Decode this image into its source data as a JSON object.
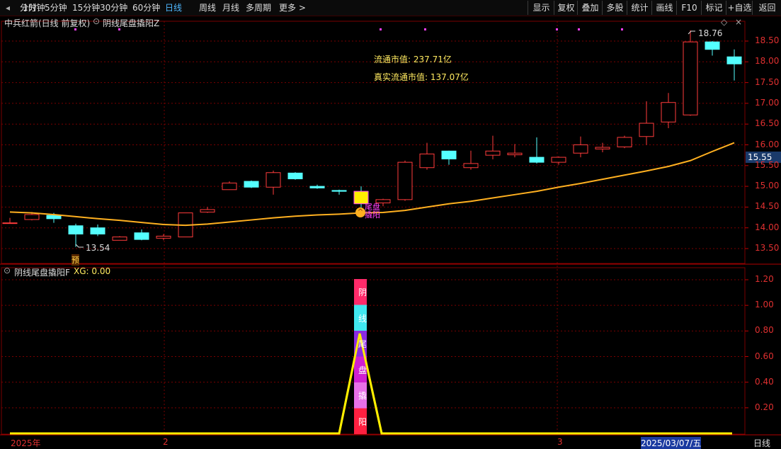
{
  "toolbar": {
    "periods": [
      "分时",
      "1分钟",
      "5分钟",
      "15分钟",
      "30分钟",
      "60分钟",
      "日线",
      "周线",
      "月线",
      "多周期",
      "更多 >"
    ],
    "active_period": "日线",
    "right_buttons": [
      "显示",
      "复权",
      "叠加",
      "多股",
      "统计",
      "画线",
      "F10",
      "标记",
      "+自选",
      "返回"
    ]
  },
  "main_panel": {
    "stock_title": "中兵红箭(日线 前复权)",
    "indicator_name": "阴线尾盘撬阳Z",
    "circ_value_label": "流通市值: 237.71亿",
    "real_circ_value_label": "真实流通市值: 137.07亿",
    "high_label": "18.76",
    "low_label": "13.54",
    "yu_marker": "预",
    "signal_label": "尾盘撬阳",
    "current_price": "15.55",
    "y_ticks": [
      "18.50",
      "18.00",
      "17.50",
      "17.00",
      "16.50",
      "16.00",
      "15.50",
      "15.00",
      "14.50",
      "14.00",
      "13.50"
    ]
  },
  "sub_panel": {
    "indicator_title": "阴线尾盘撬阳F",
    "xg_label": "XG: 0.00",
    "y_ticks": [
      "1.20",
      "1.00",
      "0.80",
      "0.60",
      "0.40",
      "0.20"
    ],
    "signal_chars": [
      "阴",
      "线",
      "尾",
      "盘",
      "撬",
      "阳"
    ]
  },
  "date_axis": {
    "labels": [
      "2025年",
      "2",
      "3"
    ],
    "highlight": "2025/03/07/五",
    "period_label": "日线"
  },
  "colors": {
    "up": "#ff3b3b",
    "down": "#54ffff",
    "ma": "#ffb020",
    "signal": "#ffee00",
    "grid": "#7a0000"
  },
  "chart_data": {
    "type": "candlestick",
    "ylim": [
      13.2,
      18.9
    ],
    "candles": [
      {
        "o": 14.12,
        "h": 14.24,
        "l": 14.12,
        "c": 14.12
      },
      {
        "o": 14.2,
        "h": 14.38,
        "l": 14.18,
        "c": 14.32
      },
      {
        "o": 14.3,
        "h": 14.36,
        "l": 14.12,
        "c": 14.22
      },
      {
        "o": 14.05,
        "h": 14.1,
        "l": 13.54,
        "c": 13.85
      },
      {
        "o": 14.0,
        "h": 14.08,
        "l": 13.8,
        "c": 13.85
      },
      {
        "o": 13.7,
        "h": 13.8,
        "l": 13.7,
        "c": 13.78
      },
      {
        "o": 13.88,
        "h": 13.96,
        "l": 13.7,
        "c": 13.72
      },
      {
        "o": 13.75,
        "h": 13.85,
        "l": 13.7,
        "c": 13.8
      },
      {
        "o": 13.78,
        "h": 14.36,
        "l": 13.78,
        "c": 14.36
      },
      {
        "o": 14.38,
        "h": 14.5,
        "l": 14.36,
        "c": 14.44
      },
      {
        "o": 14.92,
        "h": 15.12,
        "l": 14.92,
        "c": 15.08
      },
      {
        "o": 15.12,
        "h": 15.14,
        "l": 14.96,
        "c": 14.98
      },
      {
        "o": 14.98,
        "h": 15.38,
        "l": 14.8,
        "c": 15.33
      },
      {
        "o": 15.32,
        "h": 15.34,
        "l": 15.16,
        "c": 15.18
      },
      {
        "o": 15.0,
        "h": 15.04,
        "l": 14.94,
        "c": 14.96
      },
      {
        "o": 14.9,
        "h": 14.92,
        "l": 14.8,
        "c": 14.88
      },
      {
        "o": 14.88,
        "h": 15.0,
        "l": 14.38,
        "c": 14.58
      },
      {
        "o": 14.6,
        "h": 14.7,
        "l": 14.52,
        "c": 14.68
      },
      {
        "o": 14.68,
        "h": 15.62,
        "l": 14.65,
        "c": 15.58
      },
      {
        "o": 15.45,
        "h": 16.05,
        "l": 15.4,
        "c": 15.78
      },
      {
        "o": 15.85,
        "h": 15.86,
        "l": 15.52,
        "c": 15.66
      },
      {
        "o": 15.45,
        "h": 15.86,
        "l": 15.4,
        "c": 15.55
      },
      {
        "o": 15.75,
        "h": 16.22,
        "l": 15.65,
        "c": 15.85
      },
      {
        "o": 15.76,
        "h": 16.02,
        "l": 15.7,
        "c": 15.8
      },
      {
        "o": 15.7,
        "h": 16.18,
        "l": 15.55,
        "c": 15.58
      },
      {
        "o": 15.58,
        "h": 15.72,
        "l": 15.52,
        "c": 15.7
      },
      {
        "o": 15.8,
        "h": 16.2,
        "l": 15.7,
        "c": 16.0
      },
      {
        "o": 15.9,
        "h": 16.05,
        "l": 15.82,
        "c": 15.94
      },
      {
        "o": 15.95,
        "h": 16.22,
        "l": 15.92,
        "c": 16.18
      },
      {
        "o": 16.2,
        "h": 17.05,
        "l": 16.0,
        "c": 16.52
      },
      {
        "o": 16.55,
        "h": 17.25,
        "l": 16.4,
        "c": 17.02
      },
      {
        "o": 16.72,
        "h": 18.76,
        "l": 16.7,
        "c": 18.48
      },
      {
        "o": 18.48,
        "h": 18.5,
        "l": 18.15,
        "c": 18.3
      },
      {
        "o": 18.12,
        "h": 18.3,
        "l": 17.55,
        "c": 17.95
      }
    ],
    "ma": [
      14.38,
      14.36,
      14.32,
      14.27,
      14.22,
      14.18,
      14.13,
      14.08,
      14.06,
      14.09,
      14.14,
      14.19,
      14.24,
      14.28,
      14.31,
      14.33,
      14.36,
      14.37,
      14.42,
      14.5,
      14.58,
      14.64,
      14.72,
      14.8,
      14.88,
      14.98,
      15.07,
      15.17,
      15.27,
      15.37,
      15.48,
      15.62,
      15.84,
      16.05
    ],
    "signal_index": 16,
    "xg_values": [
      0,
      0,
      0,
      0,
      0,
      0,
      0,
      0,
      0,
      0,
      0,
      0,
      0,
      0,
      0,
      0,
      0.78,
      0,
      0,
      0,
      0,
      0,
      0,
      0,
      0,
      0,
      0,
      0,
      0,
      0,
      0,
      0,
      0,
      0
    ],
    "sub_ylim": [
      0,
      1.3
    ]
  }
}
